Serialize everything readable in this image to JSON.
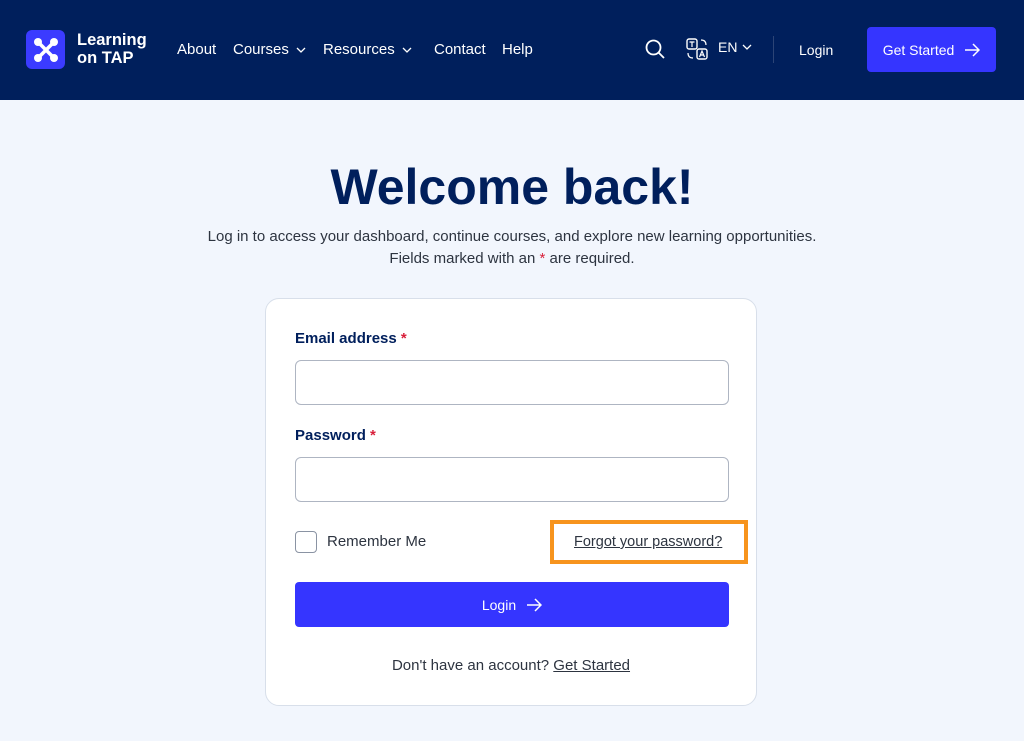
{
  "header": {
    "brand": {
      "line1": "Learning",
      "line2": "on TAP"
    },
    "nav": [
      {
        "label": "About"
      },
      {
        "label": "Courses"
      },
      {
        "label": "Resources"
      },
      {
        "label": "Contact"
      },
      {
        "label": "Help"
      }
    ],
    "language": "EN",
    "login_label": "Login",
    "cta_label": "Get Started"
  },
  "main": {
    "title": "Welcome back!",
    "subtitle_line1": "Log in to access your dashboard, continue courses, and explore new learning opportunities.",
    "subtitle_line2_prefix": "Fields marked with an",
    "subtitle_line2_star": "*",
    "subtitle_line2_suffix": "are required."
  },
  "form": {
    "email_label": "Email address",
    "email_value": "",
    "password_label": "Password",
    "password_value": "",
    "required_mark": "*",
    "remember_label": "Remember Me",
    "remember_checked": false,
    "forgot_label": "Forgot your password?",
    "submit_label": "Login",
    "signup_prompt": "Don't have an account?",
    "signup_link": "Get Started"
  },
  "colors": {
    "header_bg": "#001f5c",
    "accent": "#3535ff",
    "highlight": "#f7941d",
    "required": "#d81f3a"
  }
}
